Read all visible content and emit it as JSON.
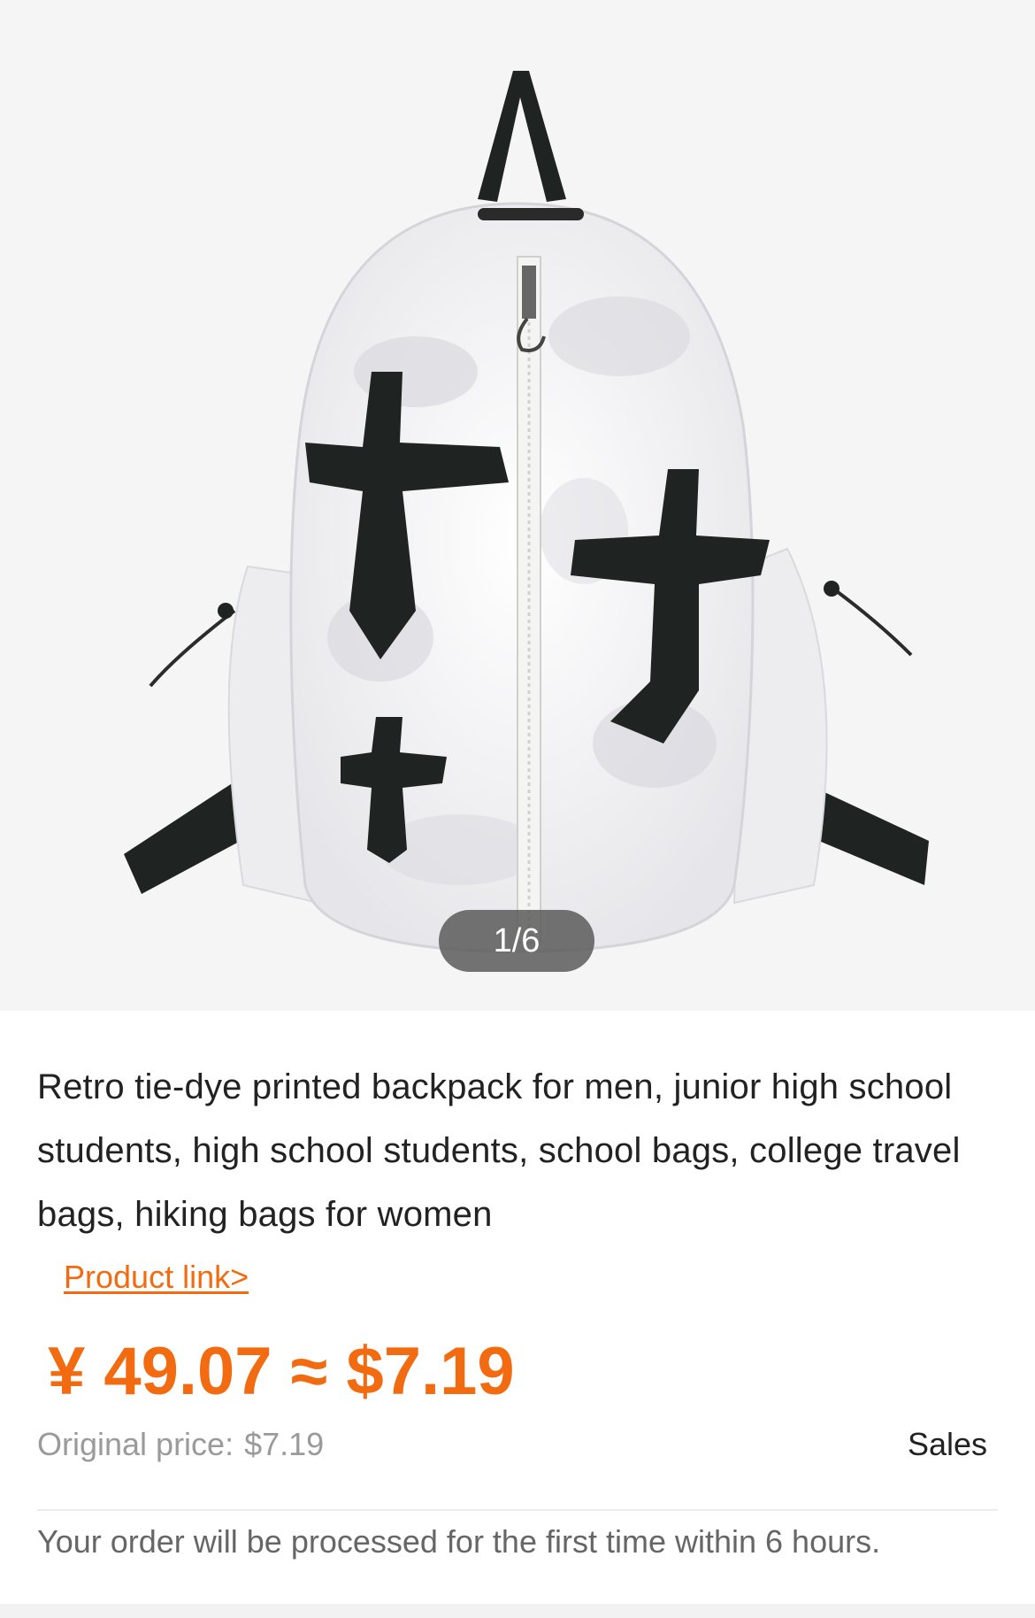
{
  "gallery": {
    "pager": "1/6",
    "image_alt": "white tie-dye backpack with black cross patches"
  },
  "product": {
    "title": "Retro tie-dye printed backpack for men, junior high school students, high school students, school bags, college travel bags, hiking bags for women",
    "link_label": "Product link>",
    "price_display": "¥ 49.07 ≈ $7.19",
    "original_price_label": "Original price:",
    "original_price_value": "$7.19",
    "sales_label": "Sales",
    "notice": "Your order will be processed for the first time within 6 hours."
  },
  "colors": {
    "accent": "#f26b10",
    "muted_text": "#9a9a9a",
    "gallery_bg": "#f5f5f5"
  }
}
